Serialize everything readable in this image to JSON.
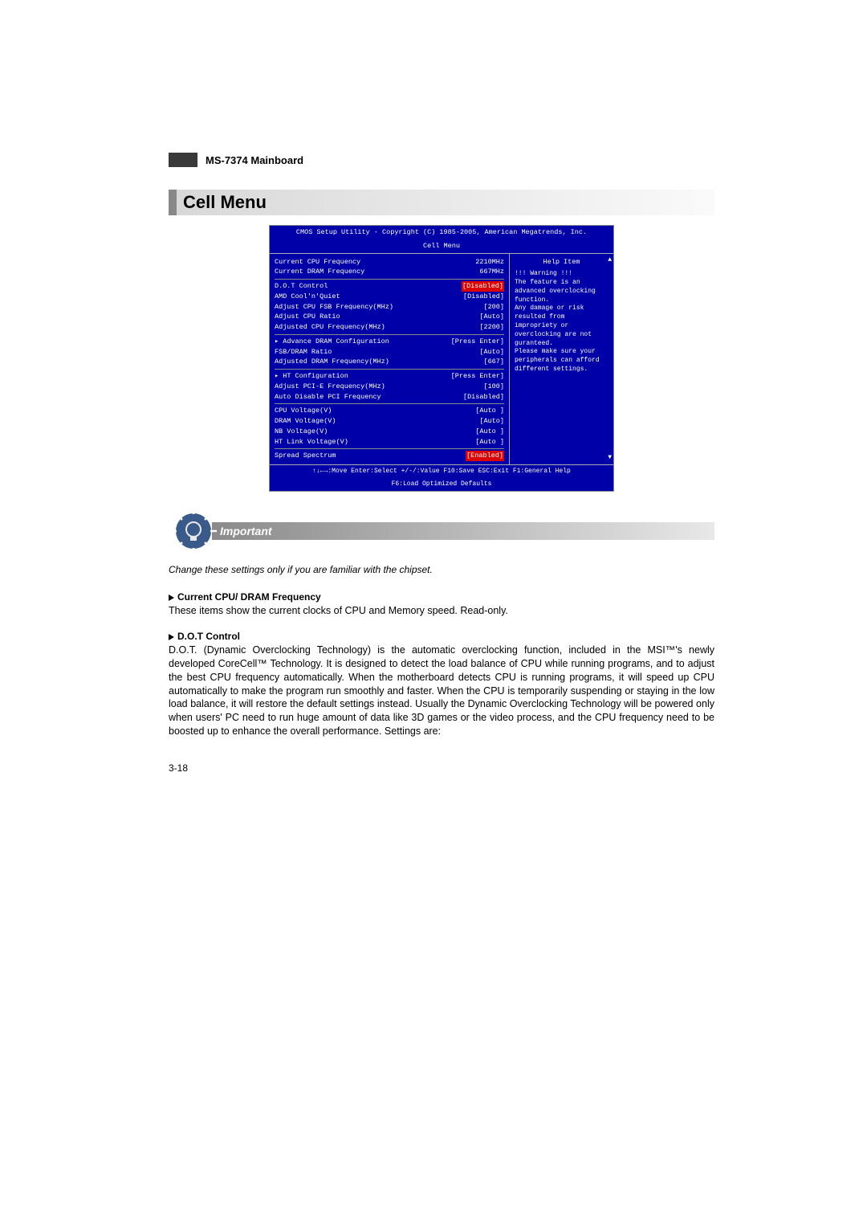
{
  "header": {
    "title": "MS-7374 Mainboard"
  },
  "section": {
    "title": "Cell Menu"
  },
  "bios": {
    "top1": "CMOS Setup Utility - Copyright (C) 1985-2005, American Megatrends, Inc.",
    "top2": "Cell Menu",
    "rows_a": [
      {
        "label": "Current CPU Frequency",
        "val": "2210MHz",
        "grey": false,
        "red": false
      },
      {
        "label": "Current DRAM Frequency",
        "val": "667MHz",
        "grey": false,
        "red": false
      }
    ],
    "rows_b": [
      {
        "label": "D.O.T Control",
        "val": "[Disabled]",
        "grey": false,
        "red": true
      },
      {
        "label": "AMD Cool'n'Quiet",
        "val": "[Disabled]",
        "grey": false,
        "red": false
      },
      {
        "label": "Adjust CPU FSB Frequency(MHz)",
        "val": "[200]",
        "grey": false,
        "red": false
      },
      {
        "label": "Adjust CPU Ratio",
        "val": "[Auto]",
        "grey": false,
        "red": false
      },
      {
        "label": "Adjusted CPU Frequency(MHz)",
        "val": "[2200]",
        "grey": true,
        "red": false
      }
    ],
    "rows_c": [
      {
        "label": "▸ Advance DRAM Configuration",
        "val": "[Press Enter]",
        "grey": false,
        "red": false
      },
      {
        "label": "FSB/DRAM Ratio",
        "val": "[Auto]",
        "grey": false,
        "red": false
      },
      {
        "label": "Adjusted DRAM Frequency(MHz)",
        "val": "[667]",
        "grey": true,
        "red": false
      }
    ],
    "rows_d": [
      {
        "label": "▸ HT Configuration",
        "val": "[Press Enter]",
        "grey": false,
        "red": false
      },
      {
        "label": "Adjust PCI-E Frequency(MHz)",
        "val": "[100]",
        "grey": false,
        "red": false
      },
      {
        "label": "Auto Disable PCI Frequency",
        "val": "[Disabled]",
        "grey": false,
        "red": false
      }
    ],
    "rows_e": [
      {
        "label": "CPU Voltage(V)",
        "val": "[Auto ]",
        "grey": false,
        "red": false
      },
      {
        "label": "DRAM Voltage(V)",
        "val": "[Auto]",
        "grey": false,
        "red": false
      },
      {
        "label": "NB Voltage(V)",
        "val": "[Auto ]",
        "grey": false,
        "red": false
      },
      {
        "label": "HT Link Voltage(V)",
        "val": "[Auto ]",
        "grey": false,
        "red": false
      }
    ],
    "rows_f": [
      {
        "label": "Spread Spectrum",
        "val": "[Enabled]",
        "grey": false,
        "red": true
      }
    ],
    "help_header": "Help Item",
    "help_text": "!!! Warning !!!\nThe feature is an advanced overclocking function.\nAny damage or risk resulted from impropriety or overclocking are not guranteed.\nPlease make sure your peripherals can afford different settings.",
    "foot1": "↑↓←→:Move  Enter:Select  +/-/:Value  F10:Save  ESC:Exit  F1:General Help",
    "foot2": "F6:Load Optimized Defaults"
  },
  "important": {
    "label": "Important",
    "note": "Change these settings only if you are familiar with the chipset."
  },
  "items": [
    {
      "heading": "Current CPU/ DRAM Frequency",
      "body": "These items show the current clocks of CPU and Memory speed. Read-only."
    },
    {
      "heading": "D.O.T Control",
      "body": "D.O.T. (Dynamic Overclocking Technology) is the automatic overclocking function, included in the MSI™'s newly developed CoreCell™ Technology. It is designed to detect the load balance of CPU while running programs, and to adjust the best CPU frequency automatically. When the motherboard detects CPU is running programs, it will speed up CPU automatically to make the program run smoothly and faster. When the CPU is temporarily suspending or staying in the low load balance, it will restore the default settings instead. Usually the Dynamic Overclocking Technology will be powered only when users' PC need to run huge amount of data like 3D games or the video process, and the CPU frequency need to be boosted up to enhance the overall performance. Settings are:"
    }
  ],
  "page_num": "3-18"
}
